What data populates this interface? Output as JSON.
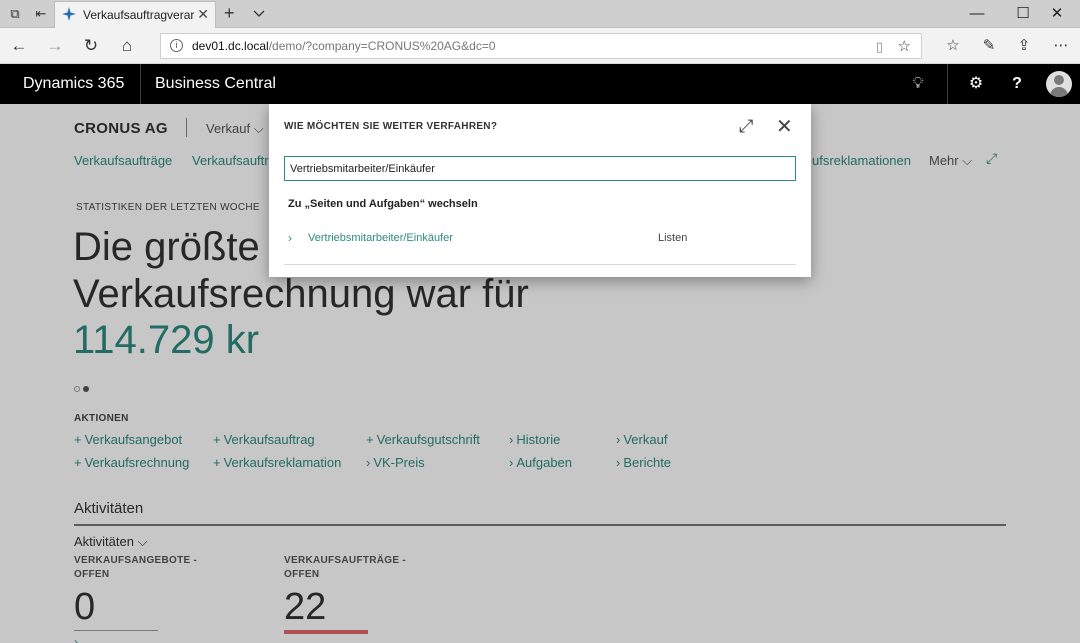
{
  "browser": {
    "tab_title": "Verkaufsauftragverarbei",
    "url_host": "dev01.dc.local",
    "url_path": "/demo/?company=CRONUS%20AG&dc=0"
  },
  "app": {
    "brand": "Dynamics 365",
    "product": "Business Central"
  },
  "page": {
    "company": "CRONUS AG",
    "menu": "Verkauf",
    "nav_links": [
      "Verkaufsaufträge",
      "Verkaufsauftr",
      "ufsreklamationen"
    ],
    "nav_more": "Mehr",
    "stat_caption": "STATISTIKEN DER LETZTEN WOCHE",
    "headline_1": "Die größte",
    "headline_2": "Verkaufsrechnung war für",
    "big_value": "114.729 kr",
    "actions_caption": "AKTIONEN",
    "actions": {
      "a1": "Verkaufsangebot",
      "a2": "Verkaufsauftrag",
      "a3": "Verkaufsgutschrift",
      "a4": "Historie",
      "a5": "Verkauf",
      "a6": "Verkaufsrechnung",
      "a7": "Verkaufsreklamation",
      "a8": "VK-Preis",
      "a9": "Aufgaben",
      "a10": "Berichte"
    },
    "activities_title": "Aktivitäten",
    "activities_group": "Aktivitäten",
    "tiles": [
      {
        "label": "VERKAUFSANGEBOTE - OFFEN",
        "value": "0",
        "color": "#9e9e9e"
      },
      {
        "label": "VERKAUFSAUFTRÄGE - OFFEN",
        "value": "22",
        "color": "#e06666"
      }
    ]
  },
  "dialog": {
    "title": "WIE MÖCHTEN SIE WEITER VERFAHREN?",
    "search_value": "Vertriebsmitarbeiter/Einkäufer",
    "section": "Zu „Seiten und Aufgaben“ wechseln",
    "result_link": "Vertriebsmitarbeiter/Einkäufer",
    "result_category": "Listen"
  },
  "colors": {
    "accent": "#2d8a7f",
    "header_bg": "#000000"
  }
}
